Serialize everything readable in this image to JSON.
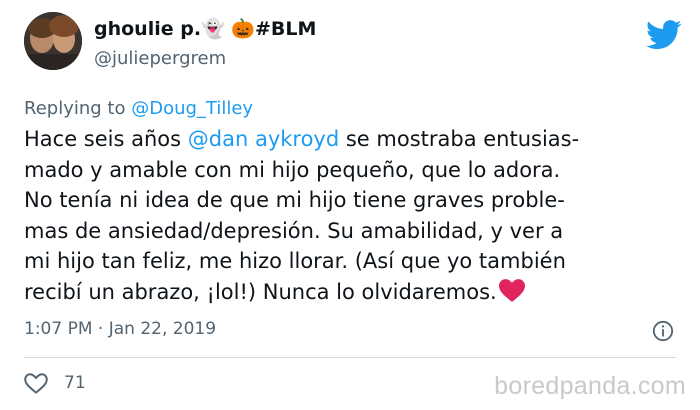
{
  "header": {
    "display_name": "ghoulie p.👻 🎃#BLM",
    "handle": "@juliepergrem"
  },
  "reply": {
    "prefix": "Replying to ",
    "mention": "@Doug_Tilley"
  },
  "tweet": {
    "line1_before": "Hace seis años ",
    "line1_mention": "@dan aykroyd",
    "line1_after": " se mostraba entusias-",
    "line2": "mado y amable con mi hijo pequeño, que lo adora.",
    "line3": "No tenía ni idea de que mi hijo tiene graves proble-",
    "line4": "mas de ansiedad/depresión. Su amabilidad, y ver a",
    "line5": "mi hijo tan feliz, me hizo llorar. (Así que yo también",
    "line6": "recibí un abrazo, ¡lol!) Nunca lo olvidaremos."
  },
  "timestamp": "1:07 PM · Jan 22, 2019",
  "likes": "71",
  "watermark": "boredpanda.com",
  "colors": {
    "link": "#1d9bf0",
    "secondary_text": "#536471",
    "heart": "#e0245e"
  },
  "icons": [
    "twitter-bird-icon",
    "info-icon",
    "heart-outline-icon",
    "red-heart-emoji"
  ]
}
